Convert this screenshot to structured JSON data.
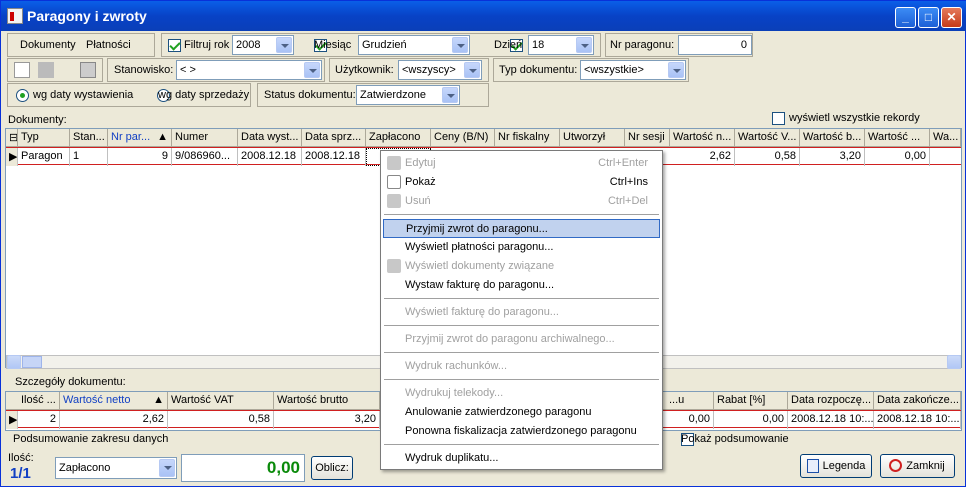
{
  "window": {
    "title": "Paragony i zwroty"
  },
  "tabs": [
    "Dokumenty",
    "Płatności"
  ],
  "filter": {
    "year_label": "Filtruj rok",
    "year": "2008",
    "month_label": "Miesiąc",
    "month": "Grudzień",
    "day_label": "Dzień",
    "day": "18",
    "receipt_no_label": "Nr paragonu:",
    "receipt_no": "0",
    "station_label": "Stanowisko:",
    "station": "< >",
    "user_label": "Użytkownik:",
    "user": "<wszyscy>",
    "doctype_label": "Typ dokumentu:",
    "doctype": "<wszystkie>",
    "radio_issue": "wg daty wystawienia",
    "radio_sale": "wg daty sprzedaży",
    "status_label": "Status dokumentu:",
    "status": "Zatwierdzone",
    "show_all": "wyświetl wszystkie rekordy"
  },
  "documents": {
    "label": "Dokumenty:",
    "columns": [
      "Typ",
      "Stan...",
      "Nr par...",
      "Numer",
      "Data wyst...",
      "Data sprz...",
      "Zapłacono",
      "Ceny (B/N)",
      "Nr fiskalny",
      "Utworzył",
      "Nr sesji",
      "Wartość n...",
      "Wartość V...",
      "Wartość b...",
      "Wartość ...",
      "Wa..."
    ],
    "row": [
      "Paragon",
      "1",
      "9",
      "9/086960...",
      "2008.12.18",
      "2008.12.18",
      "",
      "",
      "",
      "",
      "",
      "2,62",
      "0,58",
      "3,20",
      "0,00",
      ""
    ]
  },
  "details": {
    "label": "Szczegóły dokumentu:",
    "columns": [
      "Ilość ...",
      "Wartość netto",
      "Wartość VAT",
      "Wartość brutto",
      "",
      "...u",
      "Rabat [%]",
      "Data rozpoczę...",
      "Data zakończe..."
    ],
    "row": [
      "2",
      "2,62",
      "0,58",
      "3,20",
      "",
      "0,00",
      "0,00",
      "2008.12.18 10:...",
      "2008.12.18 10:..."
    ]
  },
  "summary": {
    "label": "Podsumowanie zakresu danych",
    "show_summary": "Pokaż podsumowanie"
  },
  "footer": {
    "count_label": "Ilość:",
    "count": "1/1",
    "paid_select": "Zapłacono",
    "amount": "0,00",
    "calc_button": "Oblicz:",
    "legend_button": "Legenda",
    "close_button": "Zamknij"
  },
  "context_menu": [
    {
      "label": "Edytuj",
      "shortcut": "Ctrl+Enter",
      "disabled": true
    },
    {
      "label": "Pokaż",
      "shortcut": "Ctrl+Ins",
      "disabled": false
    },
    {
      "label": "Usuń",
      "shortcut": "Ctrl+Del",
      "disabled": true
    },
    {
      "label": "Przyjmij zwrot do paragonu...",
      "shortcut": "",
      "disabled": false
    },
    {
      "label": "Wyświetl płatności paragonu...",
      "shortcut": "",
      "disabled": false
    },
    {
      "label": "Wyświetl dokumenty związane",
      "shortcut": "",
      "disabled": true
    },
    {
      "label": "Wystaw fakturę do paragonu...",
      "shortcut": "",
      "disabled": false
    },
    {
      "label": "Wyświetl fakturę do paragonu...",
      "shortcut": "",
      "disabled": true
    },
    {
      "label": "Przyjmij zwrot do paragonu archiwalnego...",
      "shortcut": "",
      "disabled": true
    },
    {
      "label": "Wydruk rachunków...",
      "shortcut": "",
      "disabled": true
    },
    {
      "label": "Wydrukuj telekody...",
      "shortcut": "",
      "disabled": true
    },
    {
      "label": "Anulowanie zatwierdzonego paragonu",
      "shortcut": "",
      "disabled": false
    },
    {
      "label": "Ponowna fiskalizacja zatwierdzonego paragonu",
      "shortcut": "",
      "disabled": false
    },
    {
      "label": "Wydruk duplikatu...",
      "shortcut": "",
      "disabled": false
    }
  ]
}
